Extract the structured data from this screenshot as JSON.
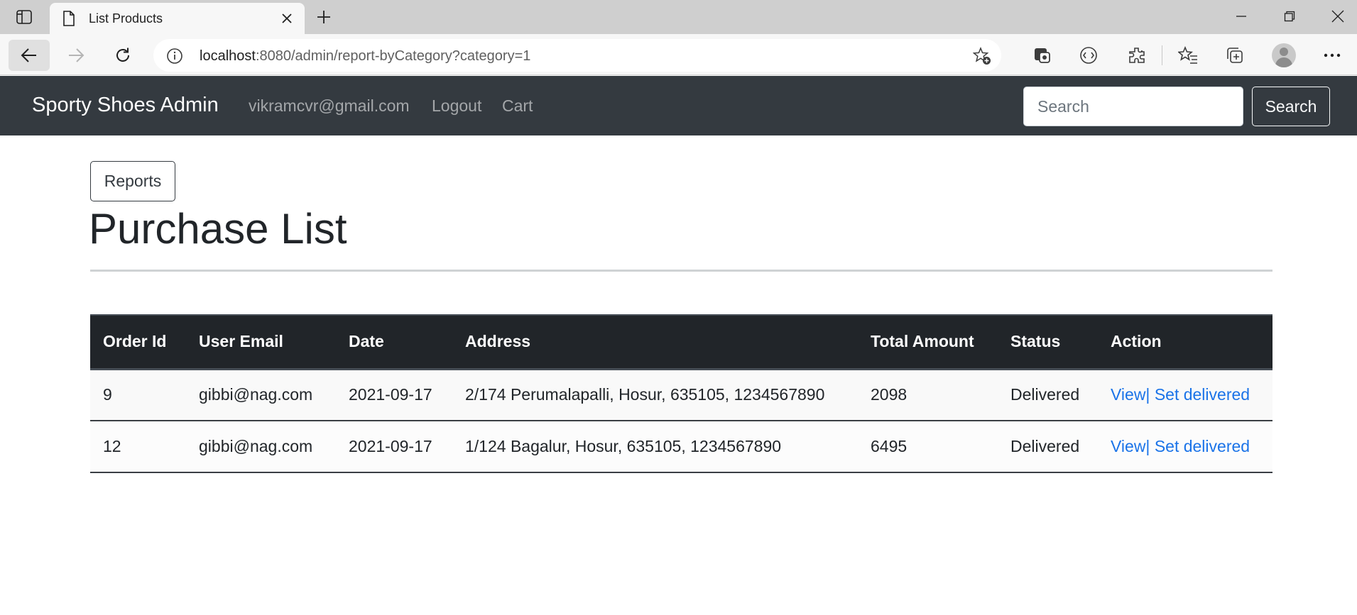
{
  "browser": {
    "tab": {
      "title": "List Products",
      "icon": "page-icon"
    },
    "address": {
      "host": "localhost",
      "rest": ":8080/admin/report-byCategory?category=1"
    }
  },
  "navbar": {
    "brand": "Sporty Shoes Admin",
    "links": [
      "vikramcvr@gmail.com",
      "Logout",
      "Cart"
    ],
    "search_placeholder": "Search",
    "search_button": "Search"
  },
  "content": {
    "reports_button": "Reports",
    "title": "Purchase List",
    "table": {
      "headers": [
        "Order Id",
        "User Email",
        "Date",
        "Address",
        "Total Amount",
        "Status",
        "Action"
      ],
      "rows": [
        {
          "order_id": "9",
          "email": "gibbi@nag.com",
          "date": "2021-09-17",
          "address": "2/174 Perumalapalli, Hosur, 635105, 1234567890",
          "total": "2098",
          "status": "Delivered",
          "view": "View|",
          "set_delivered": "Set delivered"
        },
        {
          "order_id": "12",
          "email": "gibbi@nag.com",
          "date": "2021-09-17",
          "address": "1/124 Bagalur, Hosur, 635105, 1234567890",
          "total": "6495",
          "status": "Delivered",
          "view": "View|",
          "set_delivered": "Set delivered"
        }
      ]
    }
  },
  "colors": {
    "navbar": "#343a40",
    "table_header": "#212529",
    "link": "#1a73e8"
  }
}
